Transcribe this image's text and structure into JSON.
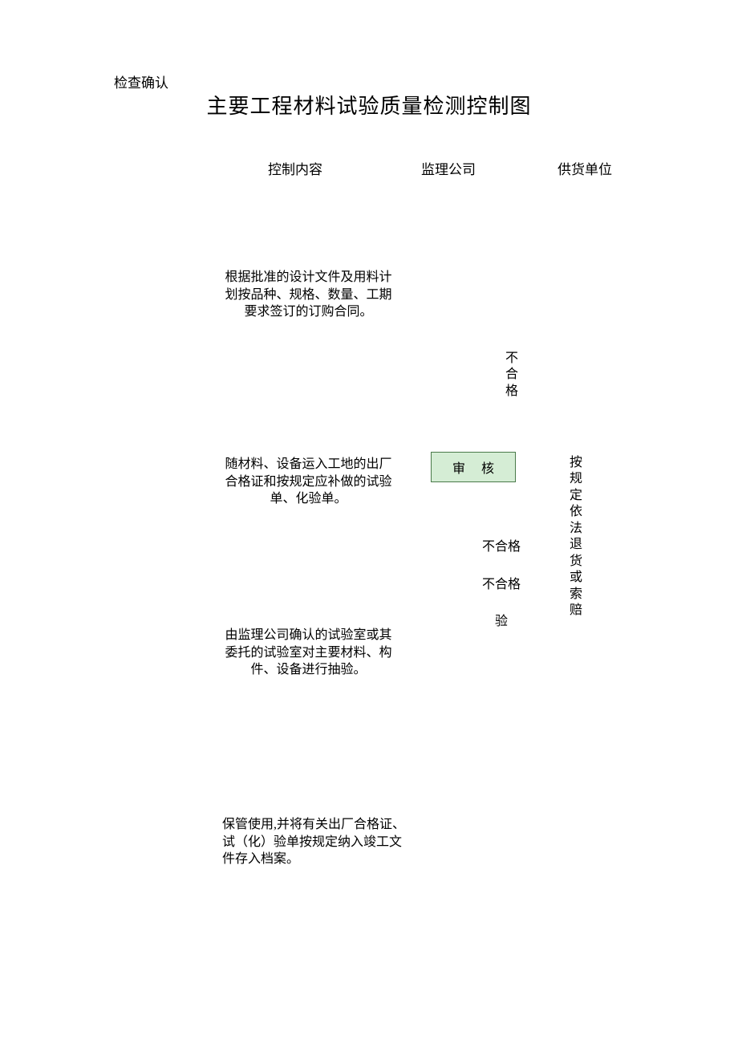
{
  "corner": "检查确认",
  "title": "主要工程材料试验质量检测控制图",
  "columns": {
    "col1": "控制内容",
    "col2": "监理公司",
    "col3": "供货单位"
  },
  "blocks": {
    "b1": "根据批准的设计文件及用料计划按品种、规格、数量、工期要求签订的订购合同。",
    "b2": "随材料、设备运入工地的出厂合格证和按规定应补做的试验单、化验单。",
    "b3": "由监理公司确认的试验室或其委托的试验室对主要材料、构件、设备进行抽验。",
    "b4": "保管使用,并将有关出厂合格证、试（化）验单按规定纳入竣工文件存入档案。"
  },
  "vertical": {
    "bhg": "不合格",
    "right": "按规定依法退货或索赔"
  },
  "audit_box": "审 核",
  "labels": {
    "bhg1": "不合格",
    "bhg2": "不合格",
    "yan": "验"
  }
}
